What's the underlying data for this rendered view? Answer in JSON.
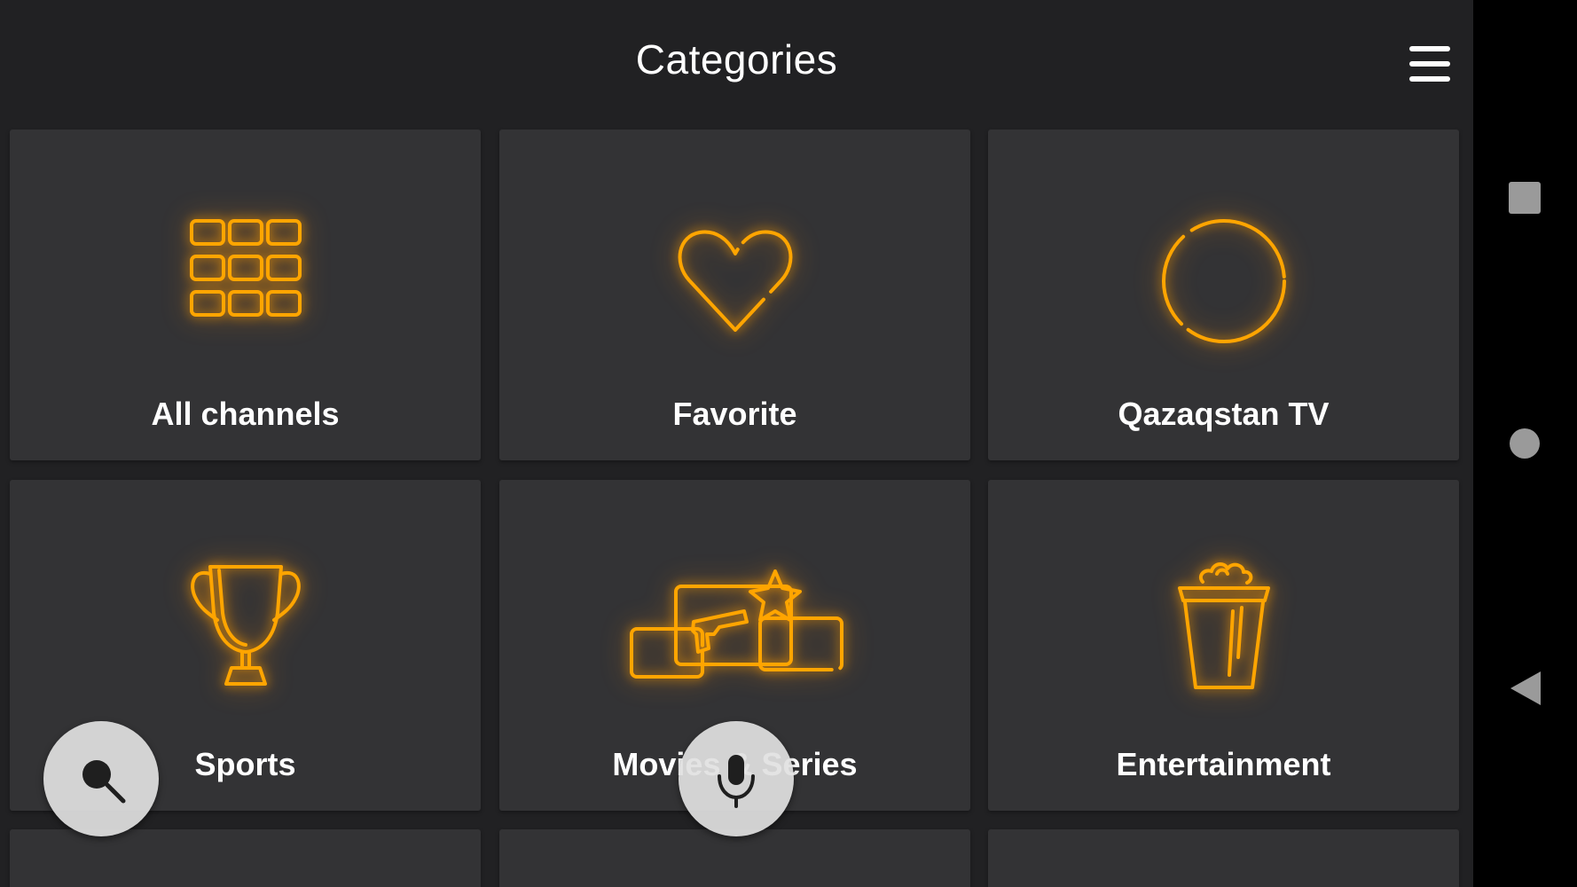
{
  "header": {
    "title": "Categories",
    "menu_icon": "hamburger-menu-icon"
  },
  "colors": {
    "background": "#212123",
    "tile": "#333335",
    "accent": "#FFA500",
    "text": "#FFFFFF",
    "fab": "#E1E1E1"
  },
  "categories": [
    {
      "label": "All channels",
      "icon": "grid-icon"
    },
    {
      "label": "Favorite",
      "icon": "heart-icon"
    },
    {
      "label": "Qazaqstan TV",
      "icon": "circle-icon"
    },
    {
      "label": "Sports",
      "icon": "trophy-icon"
    },
    {
      "label": "Movies & Series",
      "icon": "movies-icon"
    },
    {
      "label": "Entertainment",
      "icon": "popcorn-icon"
    }
  ],
  "fabs": {
    "search_icon": "search-icon",
    "mic_icon": "microphone-icon"
  },
  "system_nav": {
    "recents_icon": "square-icon",
    "home_icon": "circle-icon",
    "back_icon": "back-triangle-icon"
  }
}
